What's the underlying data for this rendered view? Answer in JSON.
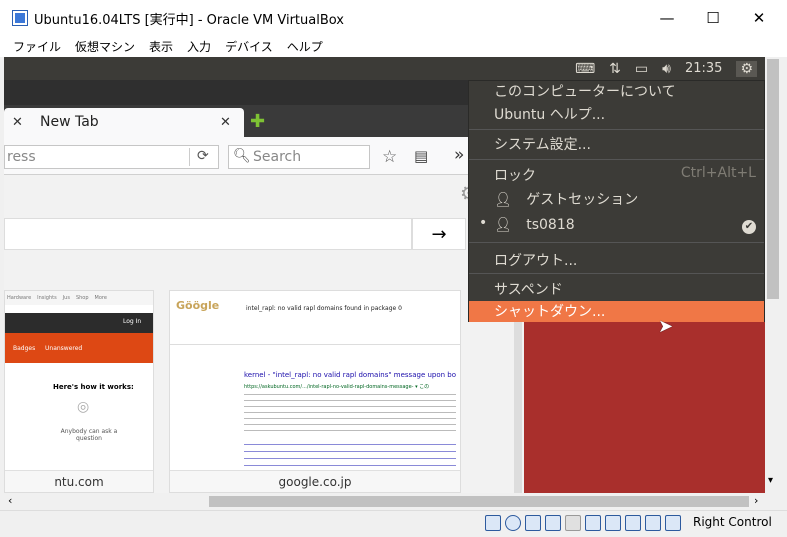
{
  "window": {
    "title": "Ubuntu16.04LTS [実行中] - Oracle VM VirtualBox",
    "minimize": "—",
    "maximize": "☐",
    "close": "✕"
  },
  "menubar": [
    "ファイル",
    "仮想マシン",
    "表示",
    "入力",
    "デバイス",
    "ヘルプ"
  ],
  "ubuntu_topbar": {
    "time": "21:35"
  },
  "firefox": {
    "tab_title": "New Tab",
    "url_placeholder": "ress",
    "search_placeholder": "Search",
    "tiles": [
      {
        "caption": "ntu.com"
      },
      {
        "caption": "google.co.jp"
      }
    ],
    "google_tile": {
      "query": "intel_rapl: no valid rapl domains found in package 0",
      "result_title": "kernel - \"intel_rapl: no valid rapl domains\" message upon bo",
      "result_url": "https://askubuntu.com/.../intel-rapl-no-valid-rapl-domains-message- ▾ この"
    },
    "askubuntu_tile": {
      "nav": [
        "Hardware",
        "Insights",
        "Jus",
        "Shop",
        "More"
      ],
      "login": "Log In",
      "tabs": [
        "Badges",
        "Unanswered"
      ],
      "heading": "Here's how it works:",
      "text": "Anybody can ask a question"
    }
  },
  "session_menu": {
    "items": [
      {
        "label": "このコンピューターについて"
      },
      {
        "label": "Ubuntu ヘルプ..."
      },
      {
        "label": "システム設定..."
      },
      {
        "label": "ロック",
        "accel": "Ctrl+Alt+L"
      },
      {
        "label": "ゲストセッション"
      },
      {
        "label": "ts0818"
      },
      {
        "label": "ログアウト..."
      },
      {
        "label": "サスペンド"
      },
      {
        "label": "シャットダウン..."
      }
    ]
  },
  "statusbar": {
    "host_key": "Right Control"
  },
  "colors": {
    "ubuntu_panel": "#3c3b37",
    "desktop_red": "#a92f2c",
    "highlight": "#f07746"
  }
}
